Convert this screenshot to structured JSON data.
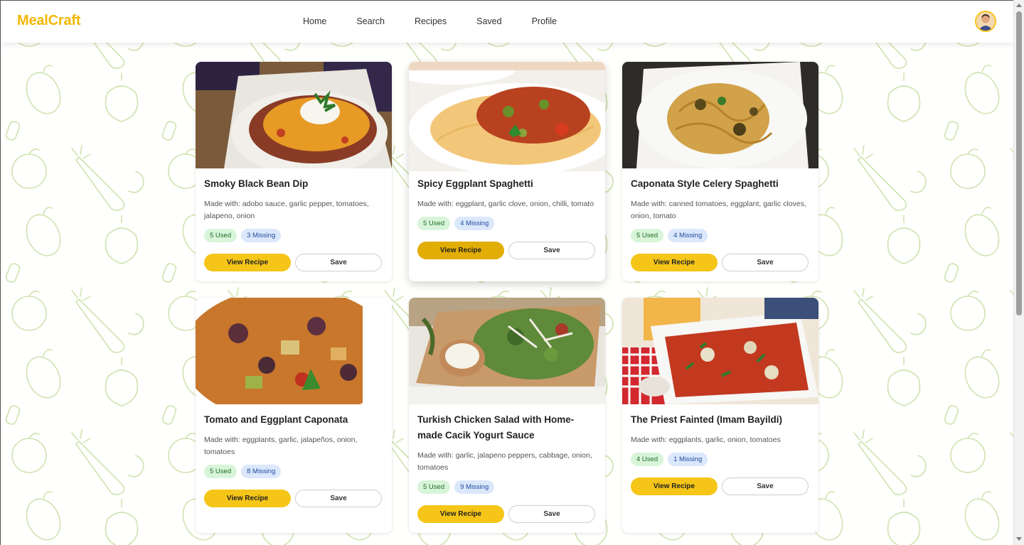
{
  "app": {
    "brand": "MealCraft",
    "brand_color": "#f2b705"
  },
  "nav": {
    "items": [
      {
        "label": "Home"
      },
      {
        "label": "Search"
      },
      {
        "label": "Recipes"
      },
      {
        "label": "Saved"
      },
      {
        "label": "Profile"
      }
    ]
  },
  "user": {
    "avatar_icon": "user-avatar"
  },
  "buttons": {
    "view_label": "View Recipe",
    "save_label": "Save"
  },
  "colors": {
    "accent": "#f5c518",
    "used_badge": "#d8f5d9",
    "missing_badge": "#dbe7fb"
  },
  "recipes": [
    {
      "title": "Smoky Black Bean Dip",
      "made_with": "Made with: adobo sauce, garlic pepper, tomatoes, jalapeno, onion",
      "used": "5 Used",
      "missing": "3 Missing"
    },
    {
      "title": "Spicy Eggplant Spaghetti",
      "made_with": "Made with: eggplant, garlic clove, onion, chilli, tomato",
      "used": "5 Used",
      "missing": "4 Missing"
    },
    {
      "title": "Caponata Style Celery Spaghetti",
      "made_with": "Made with: canned tomatoes, eggplant, garlic cloves, onion, tomato",
      "used": "5 Used",
      "missing": "4 Missing"
    },
    {
      "title": "Tomato and Eggplant Caponata",
      "made_with": "Made with: eggplants, garlic, jalapeños, onion, tomatoes",
      "used": "5 Used",
      "missing": "8 Missing"
    },
    {
      "title": "Turkish Chicken Salad with Home-made Cacik Yogurt Sauce",
      "made_with": "Made with: garlic, jalapeno peppers, cabbage, onion, tomatoes",
      "used": "5 Used",
      "missing": "9 Missing"
    },
    {
      "title": "The Priest Fainted (Imam Bayildi)",
      "made_with": "Made with: eggplants, garlic, onion, tomatoes",
      "used": "4 Used",
      "missing": "1 Missing"
    }
  ]
}
